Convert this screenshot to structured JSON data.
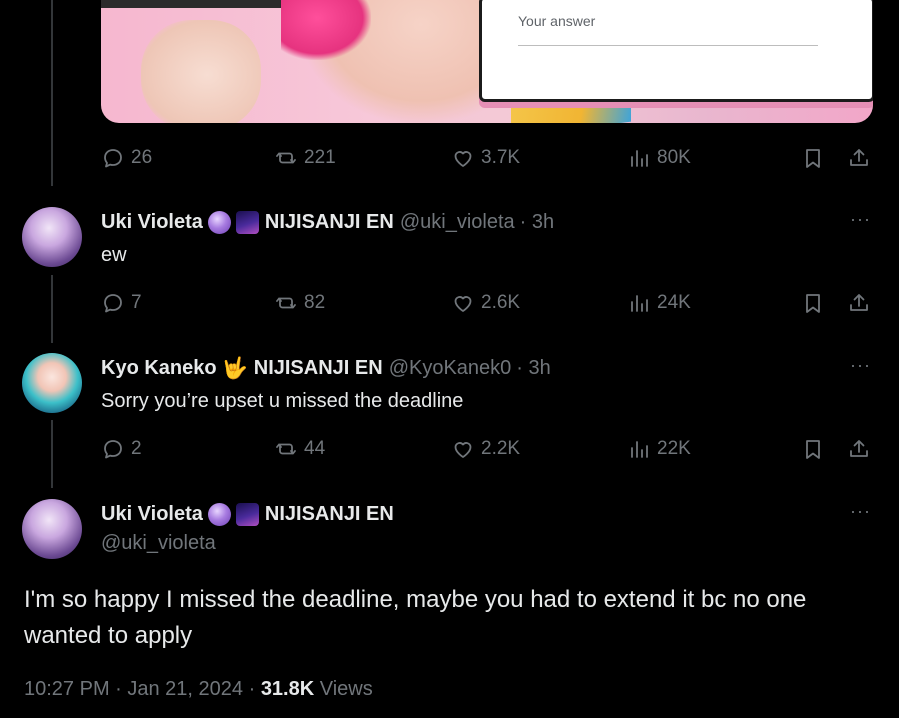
{
  "media": {
    "form_placeholder": "Your answer"
  },
  "colors": {
    "background": "#000000",
    "text": "#e7e9ea",
    "muted": "#71767b",
    "thread_line": "#333639"
  },
  "icons": [
    "reply-icon",
    "retweet-icon",
    "like-icon",
    "views-icon",
    "bookmark-icon",
    "share-icon",
    "more-icon"
  ],
  "tweets": [
    {
      "actions": {
        "replies": "26",
        "reposts": "221",
        "likes": "3.7K",
        "views": "80K"
      }
    },
    {
      "author": "Uki Violeta",
      "affiliation": "NIJISANJI EN",
      "handle": "@uki_violeta",
      "time": "· 3h",
      "text": "ew",
      "actions": {
        "replies": "7",
        "reposts": "82",
        "likes": "2.6K",
        "views": "24K"
      }
    },
    {
      "author": "Kyo Kaneko",
      "badge_emoji": "🤟",
      "affiliation": "NIJISANJI EN",
      "handle": "@KyoKanek0",
      "time": "· 3h",
      "text": "Sorry you’re upset u missed the deadline",
      "actions": {
        "replies": "2",
        "reposts": "44",
        "likes": "2.2K",
        "views": "22K"
      }
    }
  ],
  "main_tweet": {
    "author": "Uki Violeta",
    "affiliation": "NIJISANJI EN",
    "handle": "@uki_violeta",
    "text": "I'm so happy I missed the deadline, maybe you had to extend it bc no one wanted to apply",
    "timestamp": "10:27 PM · Jan 21, 2024 ·",
    "views_count": "31.8K",
    "views_label": "Views"
  },
  "more_label": "···"
}
